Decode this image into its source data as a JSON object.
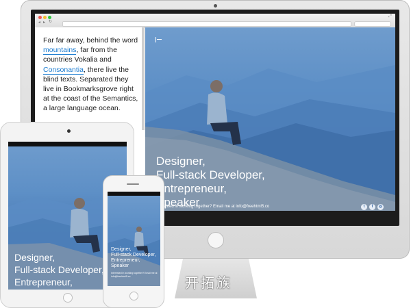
{
  "desktop": {
    "sidebar_paragraph": {
      "t1": "Far far away, behind the word ",
      "link1": "mountains",
      "t2": ", far from the countries Vokalia and ",
      "link2": "Consonantia",
      "t3": ", there live the blind texts. Separated they live in Bookmarksgrove right at the coast of the Semantics, a large language ocean."
    },
    "hero": {
      "lines": [
        "Designer,",
        "Full-stack Developer,",
        "Entrepreneur,",
        "Speaker"
      ],
      "contact": "Interested in working together? Email me at info@freehtml5.co",
      "social_icons": [
        "twitter-icon",
        "facebook-icon",
        "instagram-icon"
      ]
    }
  },
  "tablet": {
    "lines": [
      "Designer,",
      "Full-stack Developer,",
      "Entrepreneur,"
    ]
  },
  "phone": {
    "lines": [
      "Designer,",
      "Full-stack Developer,",
      "Entrepreneur,",
      "Speaker"
    ],
    "contact": "Interested in working together? Email me at info@freehtml5.co"
  },
  "watermark": "开拓族",
  "colors": {
    "link": "#1a7bd0",
    "hero_tint": "#4f7fb8"
  }
}
